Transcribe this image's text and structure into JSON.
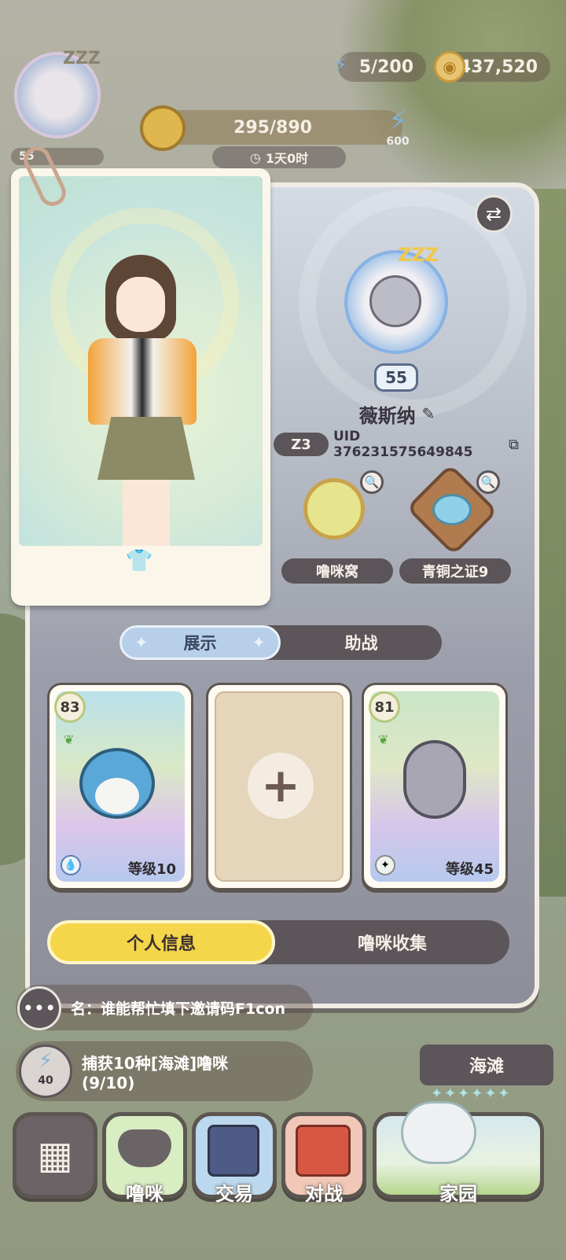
{
  "top": {
    "energy": "5/200",
    "coins": "437,520",
    "quest_progress": "295/890",
    "timer": "1天0时",
    "quest_energy": "600",
    "avatar_level": "55"
  },
  "profile": {
    "level": "55",
    "name": "薇斯纳",
    "server": "Z3",
    "uid": "UID 376231575649845",
    "badges": [
      {
        "label": "噜咪窝"
      },
      {
        "label": "青铜之证9"
      }
    ]
  },
  "tabs": {
    "show": "展示",
    "assist": "助战"
  },
  "cards": [
    {
      "level": "83",
      "grade": "等级10",
      "bg": "#b9e0ea"
    },
    {
      "empty": true
    },
    {
      "level": "81",
      "grade": "等级45",
      "bg": "#c9e6c6"
    }
  ],
  "bottom_tabs": {
    "info": "个人信息",
    "collection": "噜咪收集"
  },
  "chat": {
    "text": "名：谁能帮忙填下邀请码F1con"
  },
  "task": {
    "text_line1": "捕获10种[海滩]噜咪",
    "text_line2": "(9/10)",
    "energy": "40"
  },
  "location": {
    "name": "海滩"
  },
  "nav": {
    "pet": "噜咪",
    "trade": "交易",
    "battle": "对战",
    "home": "家园"
  },
  "colors": {
    "accent_yellow": "#f5d54a",
    "tab_active": "#b7cfe8",
    "dark_chip": "#5b5458"
  }
}
